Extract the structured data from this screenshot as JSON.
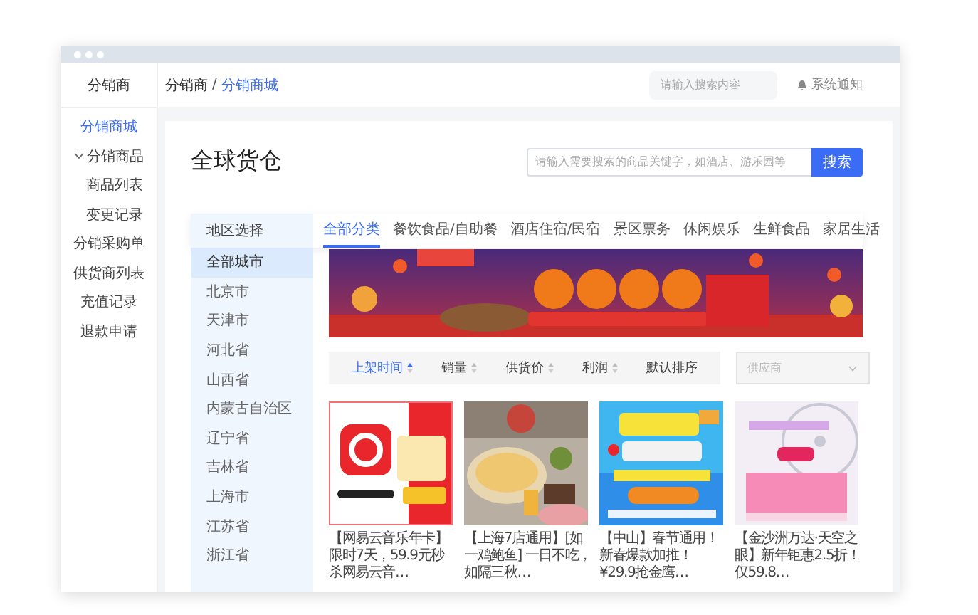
{
  "sidebar": {
    "brand": "分销商",
    "items": [
      {
        "label": "分销商城",
        "selected": true
      },
      {
        "label": "分销商品",
        "selected": false,
        "expanded": true,
        "children": [
          {
            "label": "商品列表",
            "selected": false
          },
          {
            "label": "变更记录",
            "selected": false
          }
        ]
      },
      {
        "label": "分销采购单",
        "selected": false
      },
      {
        "label": "供货商列表",
        "selected": false
      },
      {
        "label": "充值记录",
        "selected": false
      },
      {
        "label": "退款申请",
        "selected": false
      }
    ]
  },
  "header": {
    "breadcrumb": [
      "分销商",
      "分销商城"
    ],
    "breadcrumb_separator": "/",
    "search": {
      "placeholder": "请输入搜索内容"
    },
    "notice": "系统通知"
  },
  "page": {
    "title": "全球货仓",
    "search": {
      "placeholder": "请输入需要搜索的商品关键字，如酒店、游乐园等"
    },
    "search_button": "搜索"
  },
  "region": {
    "title": "地区选择",
    "items": [
      {
        "label": "全部城市",
        "selected": true
      },
      {
        "label": "北京市",
        "selected": false
      },
      {
        "label": "天津市",
        "selected": false
      },
      {
        "label": "河北省",
        "selected": false
      },
      {
        "label": "山西省",
        "selected": false
      },
      {
        "label": "内蒙古自治区",
        "selected": false
      },
      {
        "label": "辽宁省",
        "selected": false
      },
      {
        "label": "吉林省",
        "selected": false
      },
      {
        "label": "上海市",
        "selected": false
      },
      {
        "label": "江苏省",
        "selected": false
      },
      {
        "label": "浙江省",
        "selected": false
      }
    ]
  },
  "tabs": [
    {
      "label": "全部分类",
      "selected": true
    },
    {
      "label": "餐饮食品/自助餐",
      "selected": false
    },
    {
      "label": "酒店住宿/民宿",
      "selected": false
    },
    {
      "label": "景区票务",
      "selected": false
    },
    {
      "label": "休闲娱乐",
      "selected": false
    },
    {
      "label": "生鲜食品",
      "selected": false
    },
    {
      "label": "家居生活",
      "selected": false
    }
  ],
  "sort": [
    {
      "label": "上架时间",
      "selected": true,
      "sortable": true
    },
    {
      "label": "销量",
      "selected": false,
      "sortable": true
    },
    {
      "label": "供货价",
      "selected": false,
      "sortable": true
    },
    {
      "label": "利润",
      "selected": false,
      "sortable": true
    },
    {
      "label": "默认排序",
      "selected": false,
      "sortable": false
    }
  ],
  "supplier": {
    "placeholder": "供应商"
  },
  "products": [
    {
      "title": "【网易云音乐年卡】限时7天，59.9元秒杀网易云音…"
    },
    {
      "title": "【上海7店通用】[如一鸡鲍鱼] 一日不吃，如隔三秋…"
    },
    {
      "title": "【中山】春节通用！新春爆款加推！¥29.9抢金鹰…"
    },
    {
      "title": "【金沙洲万达·天空之眼】新年钜惠2.5折！仅59.8…"
    }
  ]
}
